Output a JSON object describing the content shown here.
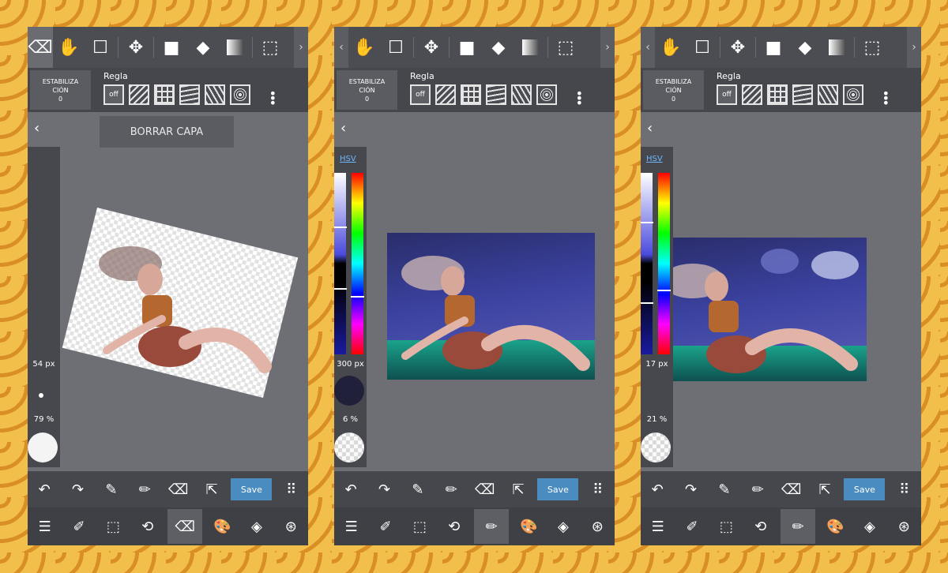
{
  "panels": [
    {
      "stab_line1": "ESTABILIZA",
      "stab_line2": "CIÓN",
      "stab_value": "0",
      "regla": "Regla",
      "off": "off",
      "size": "54 px",
      "opacity": "79 %",
      "borrar": "BORRAR CAPA"
    },
    {
      "stab_line1": "ESTABILIZA",
      "stab_line2": "CIÓN",
      "stab_value": "0",
      "regla": "Regla",
      "off": "off",
      "hsv": "HSV",
      "size": "300 px",
      "opacity": "6 %"
    },
    {
      "stab_line1": "ESTABILIZA",
      "stab_line2": "CIÓN",
      "stab_value": "0",
      "regla": "Regla",
      "off": "off",
      "hsv": "HSV",
      "size": "17 px",
      "opacity": "21 %"
    }
  ],
  "save_label": "Save"
}
